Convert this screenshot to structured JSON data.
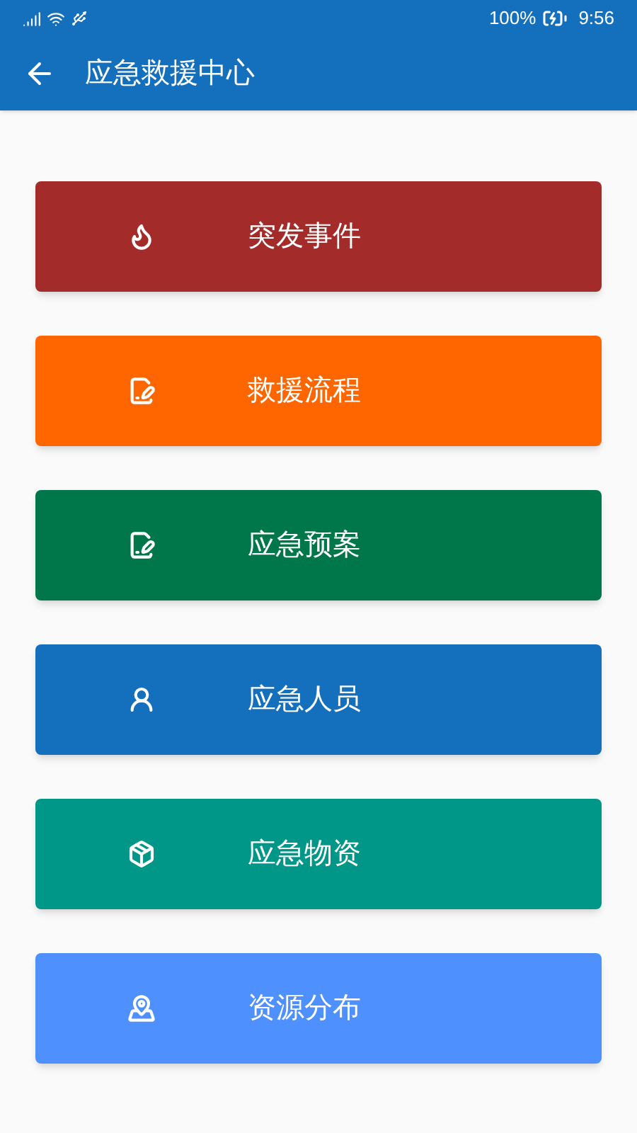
{
  "status_bar": {
    "battery": "100%",
    "time": "9:56"
  },
  "app_bar": {
    "title": "应急救援中心"
  },
  "items": [
    {
      "label": "突发事件",
      "kind": "fire",
      "color": "#a32b29"
    },
    {
      "label": "救援流程",
      "kind": "document",
      "color": "#ff6600"
    },
    {
      "label": "应急预案",
      "kind": "document",
      "color": "#00774a"
    },
    {
      "label": "应急人员",
      "kind": "person",
      "color": "#1470bd"
    },
    {
      "label": "应急物资",
      "kind": "package",
      "color": "#009688"
    },
    {
      "label": "资源分布",
      "kind": "map",
      "color": "#4d90fe"
    }
  ]
}
